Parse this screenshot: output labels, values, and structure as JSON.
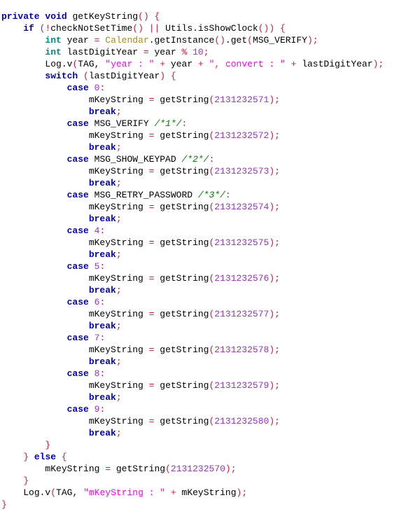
{
  "editor": {
    "language": "java",
    "background_color": "#ffffff",
    "font_size_px": 13,
    "line_height_px": 17,
    "indent_spaces": 4,
    "line_count": 42
  },
  "theme": {
    "keyword_color": "#0000CD",
    "type_color": "#008B8B",
    "class_color": "#B8860B",
    "string_color": "#FF00FF",
    "number_color": "#9932CC",
    "punctuation_color": "#DC143C",
    "comment_color": "#008000",
    "identifier_color": "#000000"
  },
  "code": {
    "method_name": "getKeyString",
    "lines": [
      {
        "indent": 0,
        "tokens": [
          {
            "t": "kw",
            "v": "private"
          },
          {
            "t": "id",
            "v": " "
          },
          {
            "t": "kw",
            "v": "void"
          },
          {
            "t": "id",
            "v": " getKeyString"
          },
          {
            "t": "pun",
            "v": "()"
          },
          {
            "t": "id",
            "v": " "
          },
          {
            "t": "pun",
            "v": "{"
          }
        ]
      },
      {
        "indent": 1,
        "tokens": [
          {
            "t": "kw",
            "v": "if"
          },
          {
            "t": "id",
            "v": " "
          },
          {
            "t": "pun",
            "v": "(!"
          },
          {
            "t": "id",
            "v": "checkNotSetTime"
          },
          {
            "t": "pun",
            "v": "()"
          },
          {
            "t": "id",
            "v": " "
          },
          {
            "t": "pun",
            "v": "||"
          },
          {
            "t": "id",
            "v": " Utils.isShowClock"
          },
          {
            "t": "pun",
            "v": "())"
          },
          {
            "t": "id",
            "v": " "
          },
          {
            "t": "pun",
            "v": "{"
          }
        ]
      },
      {
        "indent": 2,
        "tokens": [
          {
            "t": "type",
            "v": "int"
          },
          {
            "t": "id",
            "v": " year "
          },
          {
            "t": "pun",
            "v": "="
          },
          {
            "t": "id",
            "v": " "
          },
          {
            "t": "cls",
            "v": "Calendar"
          },
          {
            "t": "id",
            "v": ".getInstance"
          },
          {
            "t": "pun",
            "v": "()"
          },
          {
            "t": "id",
            "v": ".get"
          },
          {
            "t": "pun",
            "v": "("
          },
          {
            "t": "id",
            "v": "MSG_VERIFY"
          },
          {
            "t": "pun",
            "v": ");"
          }
        ]
      },
      {
        "indent": 2,
        "tokens": [
          {
            "t": "type",
            "v": "int"
          },
          {
            "t": "id",
            "v": " lastDigitYear "
          },
          {
            "t": "pun",
            "v": "="
          },
          {
            "t": "id",
            "v": " year "
          },
          {
            "t": "pun",
            "v": "%"
          },
          {
            "t": "id",
            "v": " "
          },
          {
            "t": "num",
            "v": "10"
          },
          {
            "t": "pun",
            "v": ";"
          }
        ]
      },
      {
        "indent": 2,
        "tokens": [
          {
            "t": "id",
            "v": "Log.v"
          },
          {
            "t": "pun",
            "v": "("
          },
          {
            "t": "id",
            "v": "TAG, "
          },
          {
            "t": "str",
            "v": "\"year : \""
          },
          {
            "t": "id",
            "v": " "
          },
          {
            "t": "pun",
            "v": "+"
          },
          {
            "t": "id",
            "v": " year "
          },
          {
            "t": "pun",
            "v": "+"
          },
          {
            "t": "id",
            "v": " "
          },
          {
            "t": "str",
            "v": "\", convert : \""
          },
          {
            "t": "id",
            "v": " "
          },
          {
            "t": "pun",
            "v": "+"
          },
          {
            "t": "id",
            "v": " lastDigitYear"
          },
          {
            "t": "pun",
            "v": ");"
          }
        ]
      },
      {
        "indent": 2,
        "tokens": [
          {
            "t": "kw",
            "v": "switch"
          },
          {
            "t": "id",
            "v": " "
          },
          {
            "t": "pun",
            "v": "("
          },
          {
            "t": "id",
            "v": "lastDigitYear"
          },
          {
            "t": "pun",
            "v": ")"
          },
          {
            "t": "id",
            "v": " "
          },
          {
            "t": "pun",
            "v": "{"
          }
        ]
      },
      {
        "indent": 3,
        "tokens": [
          {
            "t": "kw",
            "v": "case"
          },
          {
            "t": "id",
            "v": " "
          },
          {
            "t": "num",
            "v": "0"
          },
          {
            "t": "pun",
            "v": ":"
          }
        ]
      },
      {
        "indent": 4,
        "tokens": [
          {
            "t": "id",
            "v": "mKeyString "
          },
          {
            "t": "pun",
            "v": "="
          },
          {
            "t": "id",
            "v": " getString"
          },
          {
            "t": "pun",
            "v": "("
          },
          {
            "t": "num",
            "v": "2131232571"
          },
          {
            "t": "pun",
            "v": ");"
          }
        ]
      },
      {
        "indent": 4,
        "tokens": [
          {
            "t": "kw",
            "v": "break"
          },
          {
            "t": "pun",
            "v": ";"
          }
        ]
      },
      {
        "indent": 3,
        "tokens": [
          {
            "t": "kw",
            "v": "case"
          },
          {
            "t": "id",
            "v": " MSG_VERIFY "
          },
          {
            "t": "cmt",
            "v": "/*1*/"
          },
          {
            "t": "pun",
            "v": ":"
          }
        ]
      },
      {
        "indent": 4,
        "tokens": [
          {
            "t": "id",
            "v": "mKeyString "
          },
          {
            "t": "pun",
            "v": "="
          },
          {
            "t": "id",
            "v": " getString"
          },
          {
            "t": "pun",
            "v": "("
          },
          {
            "t": "num",
            "v": "2131232572"
          },
          {
            "t": "pun",
            "v": ");"
          }
        ]
      },
      {
        "indent": 4,
        "tokens": [
          {
            "t": "kw",
            "v": "break"
          },
          {
            "t": "pun",
            "v": ";"
          }
        ]
      },
      {
        "indent": 3,
        "tokens": [
          {
            "t": "kw",
            "v": "case"
          },
          {
            "t": "id",
            "v": " MSG_SHOW_KEYPAD "
          },
          {
            "t": "cmt",
            "v": "/*2*/"
          },
          {
            "t": "pun",
            "v": ":"
          }
        ]
      },
      {
        "indent": 4,
        "tokens": [
          {
            "t": "id",
            "v": "mKeyString "
          },
          {
            "t": "pun",
            "v": "="
          },
          {
            "t": "id",
            "v": " getString"
          },
          {
            "t": "pun",
            "v": "("
          },
          {
            "t": "num",
            "v": "2131232573"
          },
          {
            "t": "pun",
            "v": ");"
          }
        ]
      },
      {
        "indent": 4,
        "tokens": [
          {
            "t": "kw",
            "v": "break"
          },
          {
            "t": "pun",
            "v": ";"
          }
        ]
      },
      {
        "indent": 3,
        "tokens": [
          {
            "t": "kw",
            "v": "case"
          },
          {
            "t": "id",
            "v": " MSG_RETRY_PASSWORD "
          },
          {
            "t": "cmt",
            "v": "/*3*/"
          },
          {
            "t": "pun",
            "v": ":"
          }
        ]
      },
      {
        "indent": 4,
        "tokens": [
          {
            "t": "id",
            "v": "mKeyString "
          },
          {
            "t": "pun",
            "v": "="
          },
          {
            "t": "id",
            "v": " getString"
          },
          {
            "t": "pun",
            "v": "("
          },
          {
            "t": "num",
            "v": "2131232574"
          },
          {
            "t": "pun",
            "v": ");"
          }
        ]
      },
      {
        "indent": 4,
        "tokens": [
          {
            "t": "kw",
            "v": "break"
          },
          {
            "t": "pun",
            "v": ";"
          }
        ]
      },
      {
        "indent": 3,
        "tokens": [
          {
            "t": "kw",
            "v": "case"
          },
          {
            "t": "id",
            "v": " "
          },
          {
            "t": "num",
            "v": "4"
          },
          {
            "t": "pun",
            "v": ":"
          }
        ]
      },
      {
        "indent": 4,
        "tokens": [
          {
            "t": "id",
            "v": "mKeyString "
          },
          {
            "t": "pun",
            "v": "="
          },
          {
            "t": "id",
            "v": " getString"
          },
          {
            "t": "pun",
            "v": "("
          },
          {
            "t": "num",
            "v": "2131232575"
          },
          {
            "t": "pun",
            "v": ");"
          }
        ]
      },
      {
        "indent": 4,
        "tokens": [
          {
            "t": "kw",
            "v": "break"
          },
          {
            "t": "pun",
            "v": ";"
          }
        ]
      },
      {
        "indent": 3,
        "tokens": [
          {
            "t": "kw",
            "v": "case"
          },
          {
            "t": "id",
            "v": " "
          },
          {
            "t": "num",
            "v": "5"
          },
          {
            "t": "pun",
            "v": ":"
          }
        ]
      },
      {
        "indent": 4,
        "tokens": [
          {
            "t": "id",
            "v": "mKeyString "
          },
          {
            "t": "pun",
            "v": "="
          },
          {
            "t": "id",
            "v": " getString"
          },
          {
            "t": "pun",
            "v": "("
          },
          {
            "t": "num",
            "v": "2131232576"
          },
          {
            "t": "pun",
            "v": ");"
          }
        ]
      },
      {
        "indent": 4,
        "tokens": [
          {
            "t": "kw",
            "v": "break"
          },
          {
            "t": "pun",
            "v": ";"
          }
        ]
      },
      {
        "indent": 3,
        "tokens": [
          {
            "t": "kw",
            "v": "case"
          },
          {
            "t": "id",
            "v": " "
          },
          {
            "t": "num",
            "v": "6"
          },
          {
            "t": "pun",
            "v": ":"
          }
        ]
      },
      {
        "indent": 4,
        "tokens": [
          {
            "t": "id",
            "v": "mKeyString "
          },
          {
            "t": "pun",
            "v": "="
          },
          {
            "t": "id",
            "v": " getString"
          },
          {
            "t": "pun",
            "v": "("
          },
          {
            "t": "num",
            "v": "2131232577"
          },
          {
            "t": "pun",
            "v": ");"
          }
        ]
      },
      {
        "indent": 4,
        "tokens": [
          {
            "t": "kw",
            "v": "break"
          },
          {
            "t": "pun",
            "v": ";"
          }
        ]
      },
      {
        "indent": 3,
        "tokens": [
          {
            "t": "kw",
            "v": "case"
          },
          {
            "t": "id",
            "v": " "
          },
          {
            "t": "num",
            "v": "7"
          },
          {
            "t": "pun",
            "v": ":"
          }
        ]
      },
      {
        "indent": 4,
        "tokens": [
          {
            "t": "id",
            "v": "mKeyString "
          },
          {
            "t": "pun",
            "v": "="
          },
          {
            "t": "id",
            "v": " getString"
          },
          {
            "t": "pun",
            "v": "("
          },
          {
            "t": "num",
            "v": "2131232578"
          },
          {
            "t": "pun",
            "v": ");"
          }
        ]
      },
      {
        "indent": 4,
        "tokens": [
          {
            "t": "kw",
            "v": "break"
          },
          {
            "t": "pun",
            "v": ";"
          }
        ]
      },
      {
        "indent": 3,
        "tokens": [
          {
            "t": "kw",
            "v": "case"
          },
          {
            "t": "id",
            "v": " "
          },
          {
            "t": "num",
            "v": "8"
          },
          {
            "t": "pun",
            "v": ":"
          }
        ]
      },
      {
        "indent": 4,
        "tokens": [
          {
            "t": "id",
            "v": "mKeyString "
          },
          {
            "t": "pun",
            "v": "="
          },
          {
            "t": "id",
            "v": " getString"
          },
          {
            "t": "pun",
            "v": "("
          },
          {
            "t": "num",
            "v": "2131232579"
          },
          {
            "t": "pun",
            "v": ");"
          }
        ]
      },
      {
        "indent": 4,
        "tokens": [
          {
            "t": "kw",
            "v": "break"
          },
          {
            "t": "pun",
            "v": ";"
          }
        ]
      },
      {
        "indent": 3,
        "tokens": [
          {
            "t": "kw",
            "v": "case"
          },
          {
            "t": "id",
            "v": " "
          },
          {
            "t": "num",
            "v": "9"
          },
          {
            "t": "pun",
            "v": ":"
          }
        ]
      },
      {
        "indent": 4,
        "tokens": [
          {
            "t": "id",
            "v": "mKeyString "
          },
          {
            "t": "pun",
            "v": "="
          },
          {
            "t": "id",
            "v": " getString"
          },
          {
            "t": "pun",
            "v": "("
          },
          {
            "t": "num",
            "v": "2131232580"
          },
          {
            "t": "pun",
            "v": ");"
          }
        ]
      },
      {
        "indent": 4,
        "tokens": [
          {
            "t": "kw",
            "v": "break"
          },
          {
            "t": "pun",
            "v": ";"
          }
        ]
      },
      {
        "indent": 2,
        "tokens": [
          {
            "t": "pun",
            "v": "}"
          }
        ]
      },
      {
        "indent": 1,
        "tokens": [
          {
            "t": "pun",
            "v": "}"
          },
          {
            "t": "id",
            "v": " "
          },
          {
            "t": "kw",
            "v": "else"
          },
          {
            "t": "id",
            "v": " "
          },
          {
            "t": "pun",
            "v": "{"
          }
        ]
      },
      {
        "indent": 2,
        "tokens": [
          {
            "t": "id",
            "v": "mKeyString "
          },
          {
            "t": "pun",
            "v": "="
          },
          {
            "t": "id",
            "v": " getString"
          },
          {
            "t": "pun",
            "v": "("
          },
          {
            "t": "num",
            "v": "2131232570"
          },
          {
            "t": "pun",
            "v": ");"
          }
        ]
      },
      {
        "indent": 1,
        "tokens": [
          {
            "t": "pun",
            "v": "}"
          }
        ]
      },
      {
        "indent": 1,
        "tokens": [
          {
            "t": "id",
            "v": "Log.v"
          },
          {
            "t": "pun",
            "v": "("
          },
          {
            "t": "id",
            "v": "TAG, "
          },
          {
            "t": "str",
            "v": "\"mKeyString : \""
          },
          {
            "t": "id",
            "v": " "
          },
          {
            "t": "pun",
            "v": "+"
          },
          {
            "t": "id",
            "v": " mKeyString"
          },
          {
            "t": "pun",
            "v": ");"
          }
        ]
      },
      {
        "indent": 0,
        "tokens": [
          {
            "t": "pun",
            "v": "}"
          }
        ]
      }
    ]
  }
}
